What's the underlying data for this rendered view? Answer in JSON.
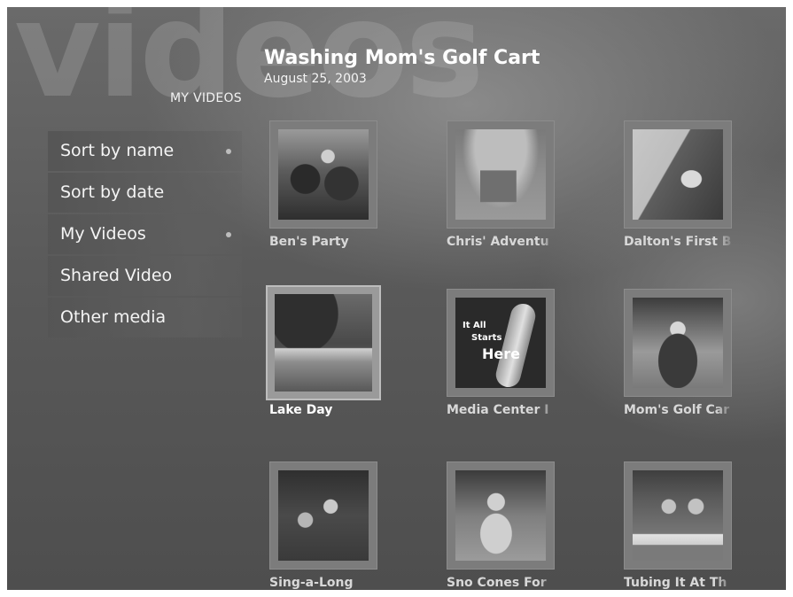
{
  "header": {
    "background_word": "videos",
    "section": "MY VIDEOS",
    "title": "Washing Mom's Golf Cart",
    "date": "August 25, 2003"
  },
  "menu": {
    "items": [
      {
        "label": "Sort by name",
        "has_dot": true
      },
      {
        "label": "Sort by date",
        "has_dot": false
      },
      {
        "label": "My Videos",
        "has_dot": true
      },
      {
        "label": "Shared Video",
        "has_dot": false
      },
      {
        "label": "Other media",
        "has_dot": false
      }
    ]
  },
  "videos": [
    {
      "caption": "Ben's Party"
    },
    {
      "caption": "Chris' Adventu"
    },
    {
      "caption": "Dalton's First B"
    },
    {
      "caption": "Lake Day",
      "selected": true
    },
    {
      "caption": "Media Center I",
      "thumb_text": [
        "It All",
        "Starts",
        "Here"
      ]
    },
    {
      "caption": "Mom's Golf Car"
    },
    {
      "caption": "Sing-a-Long"
    },
    {
      "caption": "Sno Cones For"
    },
    {
      "caption": "Tubing It At Th"
    }
  ]
}
